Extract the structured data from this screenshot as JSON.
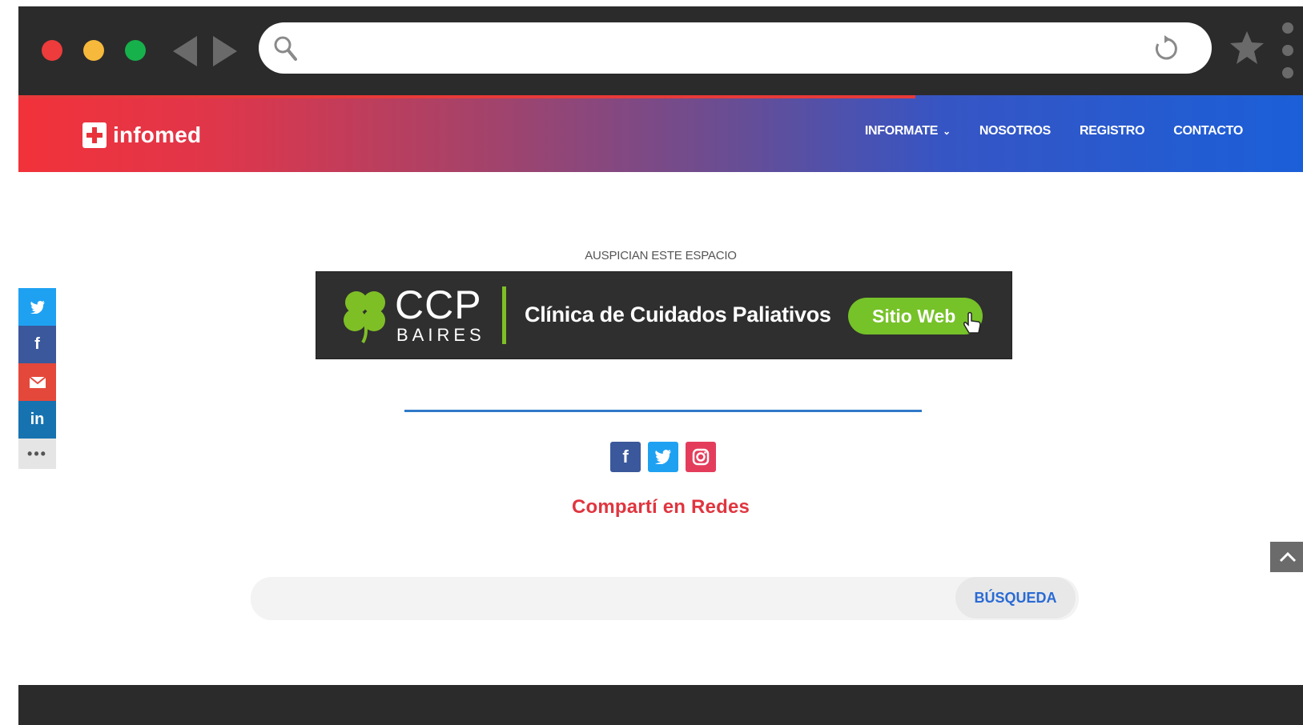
{
  "browser": {
    "url": "",
    "colors": {
      "chrome": "#2b2b2b",
      "close": "#ee3b3b",
      "minimize": "#f6b93b",
      "maximize": "#16b14b"
    }
  },
  "header": {
    "logo_text": "infomed",
    "nav": [
      {
        "label": "INFORMATE",
        "has_dropdown": true
      },
      {
        "label": "NOSOTROS"
      },
      {
        "label": "REGISTRO"
      },
      {
        "label": "CONTACTO"
      }
    ]
  },
  "sponsor": {
    "label": "AUSPICIAN ESTE ESPACIO",
    "brand": "CCP",
    "brand_sub": "BAIRES",
    "title": "Clínica de Cuidados Paliativos",
    "button": "Sitio Web"
  },
  "share": {
    "text": "Compartí en Redes",
    "icons": [
      "facebook-icon",
      "twitter-icon",
      "instagram-icon"
    ]
  },
  "search": {
    "placeholder": "",
    "button": "BÚSQUEDA"
  },
  "side_share": {
    "items": [
      "twitter",
      "facebook",
      "email",
      "linkedin",
      "more"
    ],
    "more_label": "•••"
  }
}
